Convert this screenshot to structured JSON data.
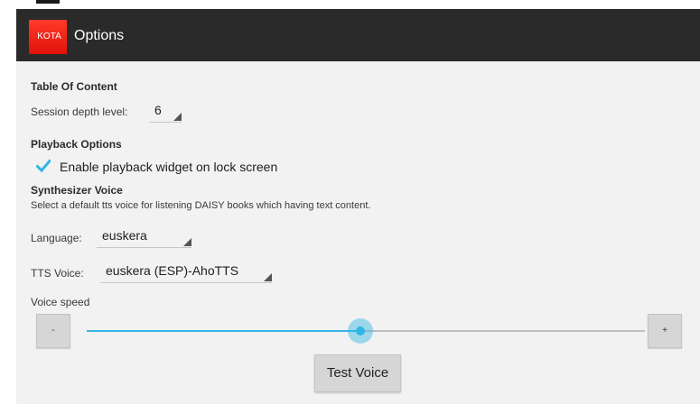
{
  "header": {
    "logo_text": "KOTA",
    "title": "Options"
  },
  "toc": {
    "header": "Table Of Content",
    "depth_label": "Session depth level:",
    "depth_value": "6"
  },
  "playback": {
    "header": "Playback Options",
    "lock_widget_label": "Enable playback widget on lock screen",
    "lock_widget_checked": true
  },
  "synth": {
    "header": "Synthesizer Voice",
    "description": "Select a default tts voice for listening DAISY books which having text content.",
    "language_label": "Language:",
    "language_value": "euskera",
    "tts_label": "TTS Voice:",
    "tts_value": "euskera (ESP)-AhoTTS",
    "speed_label": "Voice speed",
    "speed_decrease": "-",
    "speed_increase": "+",
    "speed_fraction": 0.49,
    "test_button": "Test Voice"
  },
  "colors": {
    "accent": "#33b5e5",
    "action_bar": "#2a2a2a",
    "logo": "#e0120a"
  }
}
